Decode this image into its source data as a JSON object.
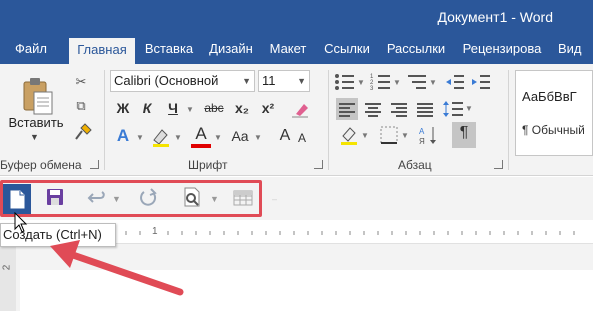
{
  "window": {
    "title": "Документ1 - Word"
  },
  "tabs": [
    {
      "label": "Файл",
      "active": false
    },
    {
      "label": "Главная",
      "active": true
    },
    {
      "label": "Вставка",
      "active": false
    },
    {
      "label": "Дизайн",
      "active": false
    },
    {
      "label": "Макет",
      "active": false
    },
    {
      "label": "Ссылки",
      "active": false
    },
    {
      "label": "Рассылки",
      "active": false
    },
    {
      "label": "Рецензирова",
      "active": false
    },
    {
      "label": "Вид",
      "active": false
    }
  ],
  "clipboard": {
    "paste_label": "Вставить",
    "group_label": "Буфер обмена"
  },
  "font": {
    "family": "Calibri (Основной",
    "size": "11",
    "bold": "Ж",
    "italic": "К",
    "underline": "Ч",
    "strikethrough": "abc",
    "subscript": "x₂",
    "superscript": "x²",
    "grow": "A",
    "shrink": "A",
    "case": "Aa",
    "text_effects": "A",
    "font_color": "A",
    "group_label": "Шрифт"
  },
  "paragraph": {
    "show_marks": "¶",
    "group_label": "Абзац"
  },
  "styles": {
    "sample": "АаБбВвГ",
    "name": "¶ Обычный"
  },
  "tooltip": {
    "text": "Создать (Ctrl+N)"
  },
  "ruler": {
    "vertical_mark": "2",
    "horizontal_mark": "1"
  },
  "colors": {
    "brand": "#2b579a",
    "ribbon": "#f3f3f3",
    "highlight": "#e04b56",
    "font_color_bar": "#e00000",
    "save_icon": "#6a3fa0"
  }
}
